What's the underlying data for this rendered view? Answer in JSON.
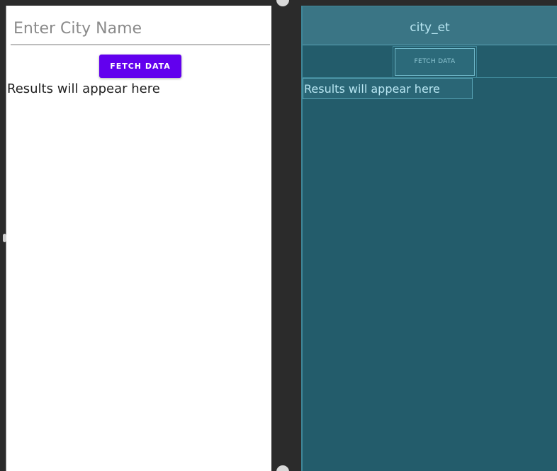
{
  "design": {
    "city_input_placeholder": "Enter City Name",
    "fetch_button_label": "FETCH DATA",
    "results_text": "Results will appear here",
    "accent_color": "#6200ee"
  },
  "blueprint": {
    "city_input_id": "city_et",
    "fetch_button_label": "FETCH DATA",
    "results_text": "Results will appear here",
    "background_color": "#235c6b"
  }
}
